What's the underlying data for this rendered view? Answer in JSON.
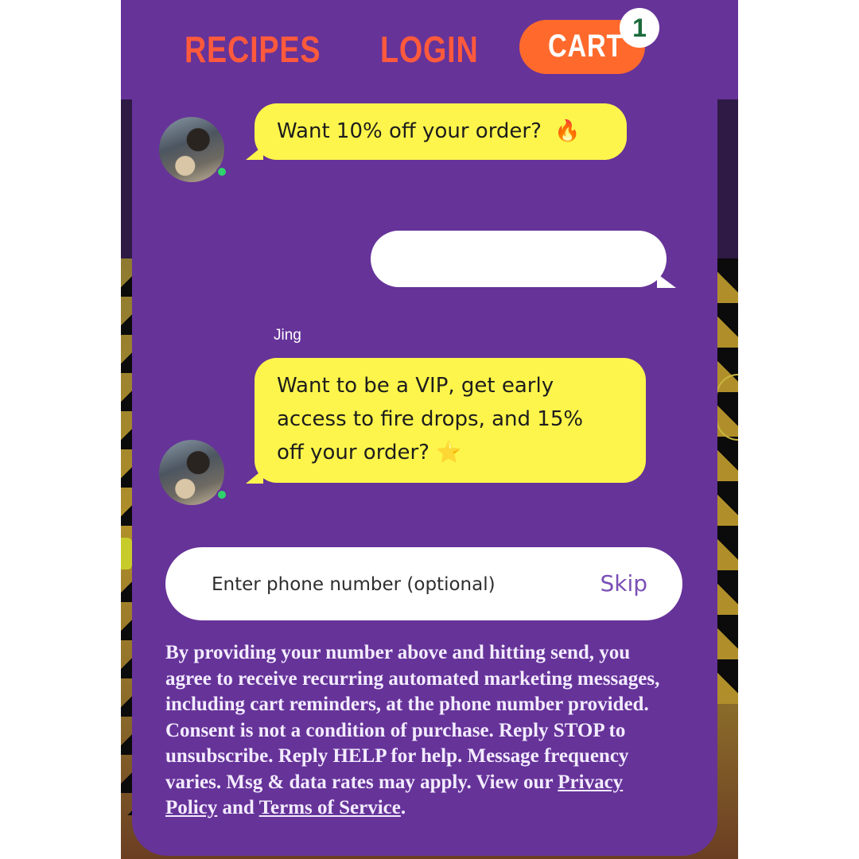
{
  "nav": {
    "recipes": "RECIPES",
    "login": "LOGIN",
    "cart": "CART",
    "cart_count": "1"
  },
  "chat": {
    "messages": [
      {
        "from": "bot",
        "text": "Want 10% off your order?",
        "emoji": "🔥",
        "emoji_icon": "fire-icon"
      },
      {
        "from": "user",
        "text": ""
      },
      {
        "from": "bot",
        "sender": "Jing",
        "lines": [
          "Want to be a VIP, get early",
          "access to fire drops, and 15%",
          "off your order?"
        ],
        "emoji": "⭐",
        "emoji_icon": "star-icon"
      }
    ]
  },
  "phone": {
    "placeholder": "Enter phone number (optional)",
    "value": "",
    "skip_label": "Skip"
  },
  "legal": {
    "text": "By providing your number above and hitting send, you agree to receive recurring automated marketing messages, including cart reminders, at the phone number provided. Consent is not a condition of purchase. Reply STOP to unsubscribe. Reply HELP for help. Message frequency varies. Msg & data rates may apply. View our",
    "privacy_link": "Privacy Policy",
    "connector": "and",
    "terms_link": "Terms of Service",
    "end": "."
  },
  "colors": {
    "purple": "#663399",
    "nav_link": "#ff5a3c",
    "cart_button": "#ff6a2c",
    "bubble": "#fdf54b",
    "online": "#2fd36b",
    "skip": "#7a4fb5"
  }
}
